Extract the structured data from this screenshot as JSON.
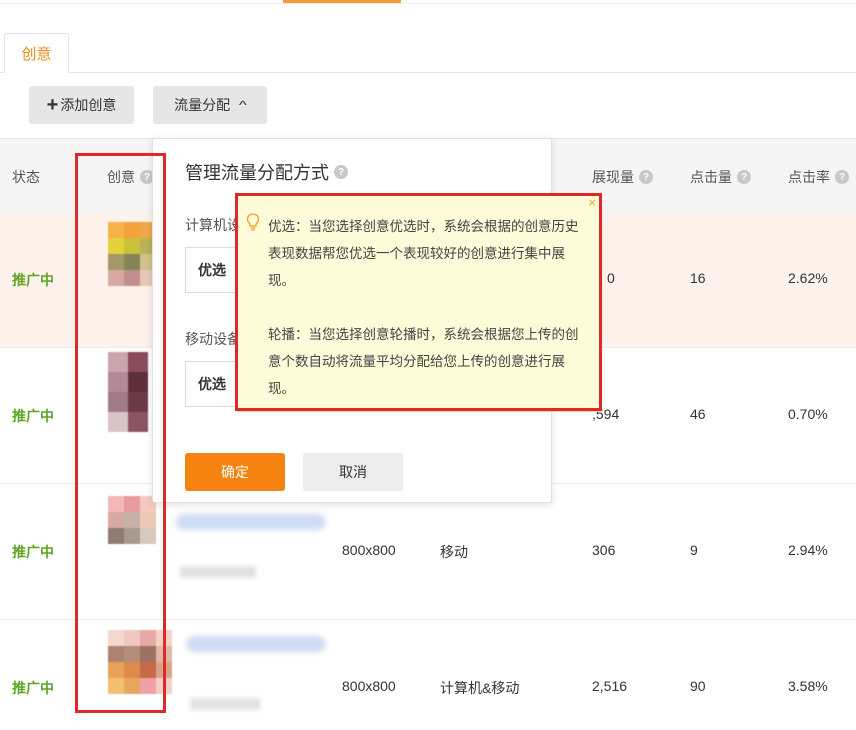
{
  "tab": {
    "label": "创意"
  },
  "toolbar": {
    "add_label": "添加创意",
    "add_icon": "+",
    "flow_label": "流量分配",
    "flow_chevron": "^"
  },
  "table": {
    "headers": {
      "status": "状态",
      "creative": "创意",
      "impressions": "展现量",
      "clicks": "点击量",
      "ctr": "点击率"
    },
    "rows": [
      {
        "status": "推广中",
        "size": "",
        "platform": "",
        "impressions": "0",
        "clicks": "16",
        "ctr": "2.62%"
      },
      {
        "status": "推广中",
        "size": "",
        "platform": "",
        "impressions": ",594",
        "clicks": "46",
        "ctr": "0.70%"
      },
      {
        "status": "推广中",
        "size": "800x800",
        "platform": "移动",
        "impressions": "306",
        "clicks": "9",
        "ctr": "2.94%"
      },
      {
        "status": "推广中",
        "size": "800x800",
        "platform": "计算机&移动",
        "impressions": "2,516",
        "clicks": "90",
        "ctr": "3.58%"
      }
    ]
  },
  "panel": {
    "title": "管理流量分配方式",
    "computer_label": "计算机设",
    "computer_value": "优选",
    "mobile_label": "移动设备",
    "mobile_value": "优选",
    "ok_label": "确定",
    "cancel_label": "取消"
  },
  "tooltip": {
    "close": "×",
    "para1": "优选：当您选择创意优选时，系统会根据的创意历史表现数据帮您优选一个表现较好的创意进行集中展现。",
    "para2": "轮播：当您选择创意轮播时，系统会根据您上传的创意个数自动将流量平均分配给您上传的创意进行展现。"
  },
  "colors": {
    "accent_orange": "#f5830f",
    "status_green": "#5fa323",
    "highlight_red": "#e02828",
    "tooltip_bg": "#fefbd8"
  }
}
